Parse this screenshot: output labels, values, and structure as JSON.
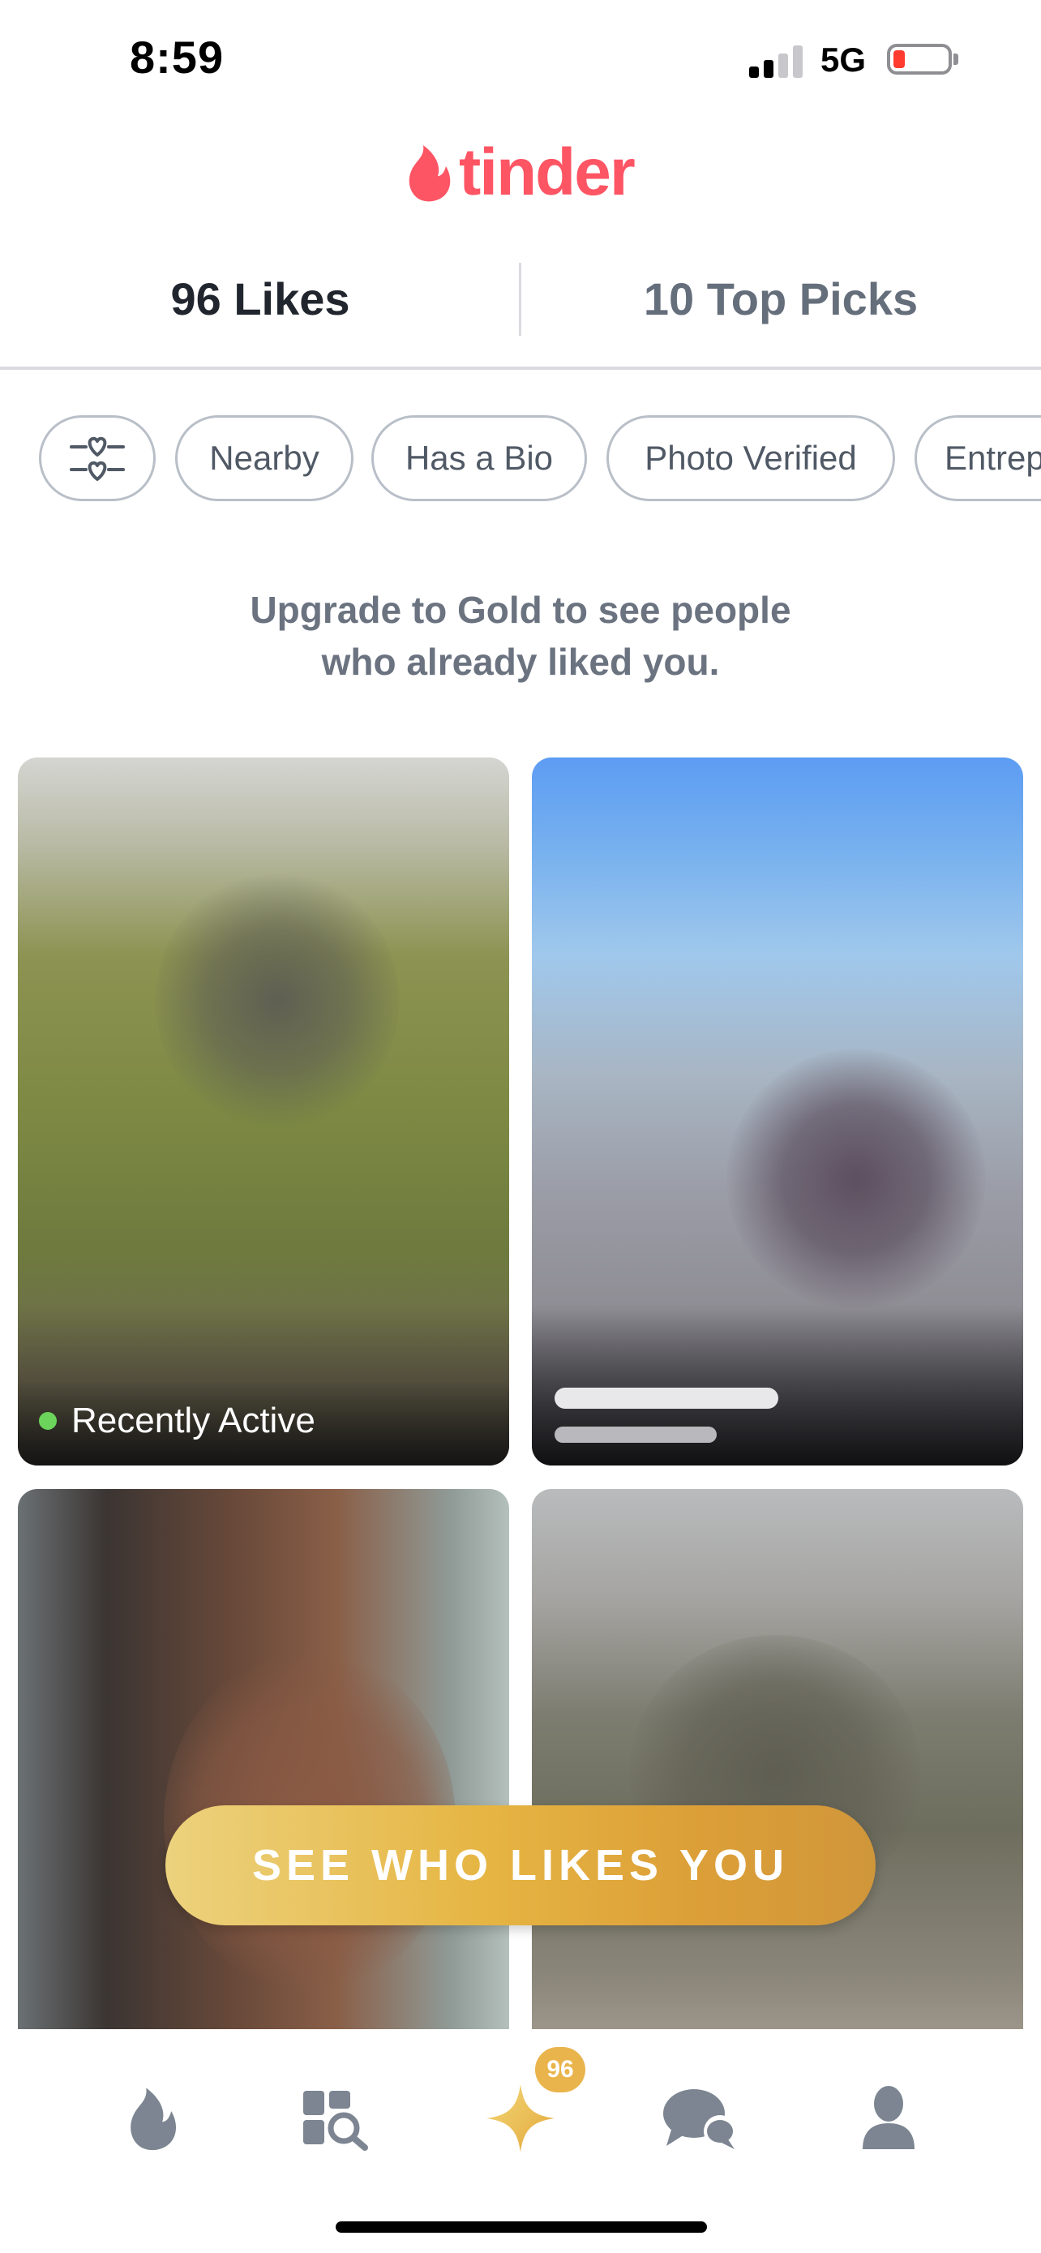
{
  "status_bar": {
    "time": "8:59",
    "network": "5G",
    "battery_percent": 10
  },
  "brand": {
    "logo_text": "tinder",
    "accent": "#fd5564"
  },
  "tabs": [
    {
      "label": "96 Likes",
      "active": true
    },
    {
      "label": "10 Top Picks",
      "active": false
    }
  ],
  "filters": {
    "icon": "filter-hearts-icon",
    "chips": [
      "Nearby",
      "Has a Bio",
      "Photo Verified",
      "Entrep"
    ]
  },
  "upsell_line1": "Upgrade to Gold to see people",
  "upsell_line2": "who already liked you.",
  "cards": [
    {
      "badge": "Recently Active",
      "status_color": "#6cd45b"
    },
    {
      "badge": ""
    },
    {
      "badge": ""
    },
    {
      "badge": ""
    }
  ],
  "cta": {
    "label": "SEE WHO LIKES YOU",
    "gold": "#e6b543"
  },
  "bottom_nav": {
    "items": [
      "flame-icon",
      "explore-icon",
      "likes-star-icon",
      "messages-icon",
      "profile-icon"
    ],
    "likes_badge": "96"
  }
}
